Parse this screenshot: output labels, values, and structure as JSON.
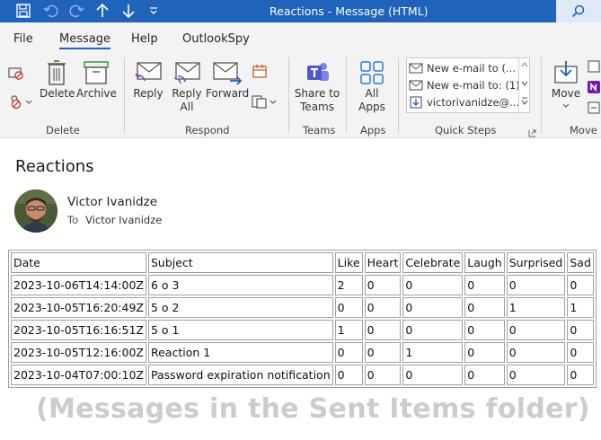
{
  "titlebar": {
    "title": "Reactions  -  Message (HTML)"
  },
  "menu": {
    "tabs": [
      {
        "label": "File"
      },
      {
        "label": "Message"
      },
      {
        "label": "Help"
      },
      {
        "label": "OutlookSpy"
      }
    ],
    "active_tab": "Message"
  },
  "ribbon": {
    "delete_group": {
      "label": "Delete",
      "delete": "Delete",
      "archive": "Archive"
    },
    "respond_group": {
      "label": "Respond",
      "reply": "Reply",
      "reply_all_line1": "Reply",
      "reply_all_line2": "All",
      "forward": "Forward"
    },
    "teams_group": {
      "label": "Teams",
      "share_line1": "Share to",
      "share_line2": "Teams"
    },
    "apps_group": {
      "label": "Apps",
      "all_apps_line1": "All",
      "all_apps_line2": "Apps"
    },
    "quick_steps": {
      "label": "Quick Steps",
      "items": [
        "New e-mail to (...",
        "New e-mail to: (1)",
        "victorivanidze@..."
      ]
    },
    "move_group": {
      "label": "Move",
      "move": "Move"
    }
  },
  "message": {
    "subject": "Reactions",
    "sender": "Victor Ivanidze",
    "to_label": "To",
    "to_value": "Victor Ivanidze"
  },
  "table": {
    "headers": [
      "Date",
      "Subject",
      "Like",
      "Heart",
      "Celebrate",
      "Laugh",
      "Surprised",
      "Sad"
    ],
    "rows": [
      [
        "2023-10-06T14:14:00Z",
        "6 o 3",
        "2",
        "0",
        "0",
        "0",
        "0",
        "0"
      ],
      [
        "2023-10-05T16:20:49Z",
        "5 o 2",
        "0",
        "0",
        "0",
        "0",
        "1",
        "1"
      ],
      [
        "2023-10-05T16:16:51Z",
        "5 o 1",
        "1",
        "0",
        "0",
        "0",
        "0",
        "0"
      ],
      [
        "2023-10-05T12:16:00Z",
        "Reaction 1",
        "0",
        "0",
        "1",
        "0",
        "0",
        "0"
      ],
      [
        "2023-10-04T07:00:10Z",
        "Password expiration notification",
        "0",
        "0",
        "0",
        "0",
        "0",
        "0"
      ]
    ]
  },
  "footer_note": "(Messages in the Sent Items folder)",
  "colors": {
    "titlebar": "#1f63bb",
    "ribbon_bg": "#f3f3f3",
    "accent": "#1f63bb"
  }
}
